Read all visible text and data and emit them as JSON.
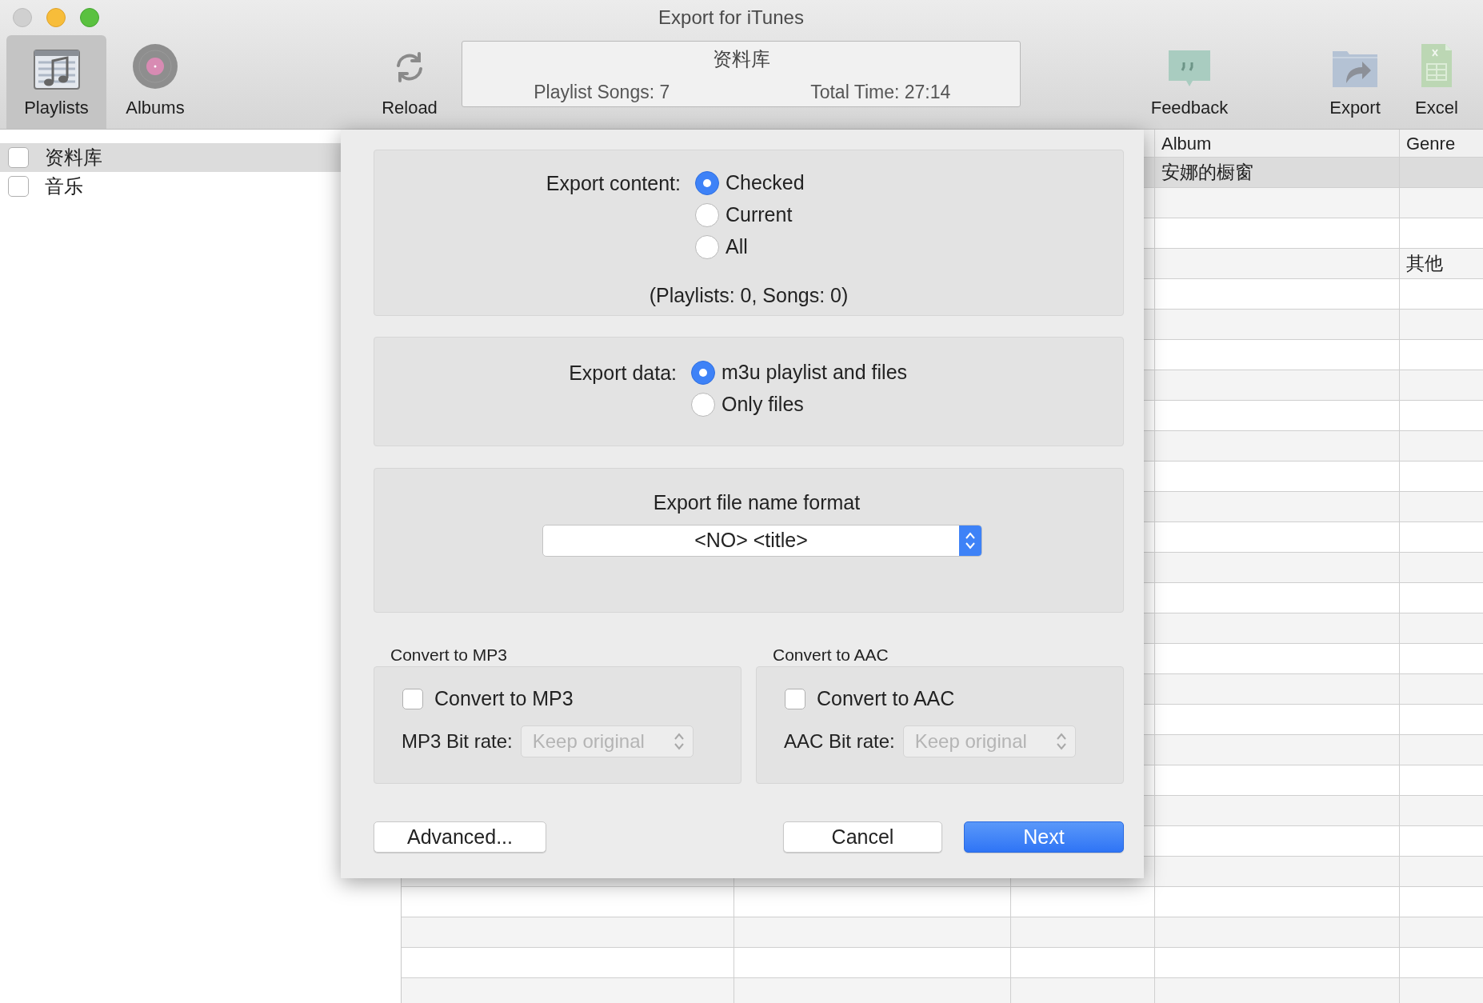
{
  "window": {
    "title": "Export for iTunes"
  },
  "toolbar": {
    "views": [
      {
        "label": "Playlists",
        "kind": "playlists",
        "selected": true
      },
      {
        "label": "Albums",
        "kind": "albums",
        "selected": false
      }
    ],
    "reload": {
      "label": "Reload"
    },
    "info": {
      "title": "资料库",
      "songs": "Playlist Songs: 7",
      "time": "Total Time: 27:14"
    },
    "actions": [
      {
        "label": "Feedback",
        "kind": "feedback"
      },
      {
        "label": "Export",
        "kind": "export"
      },
      {
        "label": "Excel",
        "kind": "excel"
      }
    ]
  },
  "sidebar": {
    "items": [
      {
        "label": "资料库",
        "checked": false,
        "selected": true
      },
      {
        "label": "音乐",
        "checked": false,
        "selected": false
      }
    ]
  },
  "table": {
    "columns": [
      "Album",
      "Genre"
    ],
    "rows": [
      {
        "album": "安娜的橱窗",
        "selected": true
      },
      {
        "selected": false
      },
      {
        "selected": false
      },
      {
        "genre": "其他",
        "selected": false
      }
    ]
  },
  "dialog": {
    "export_content": {
      "label": "Export content:",
      "options": [
        {
          "label": "Checked",
          "selected": true
        },
        {
          "label": "Current",
          "selected": false
        },
        {
          "label": "All",
          "selected": false
        }
      ],
      "summary": "(Playlists: 0, Songs: 0)"
    },
    "export_data": {
      "label": "Export data:",
      "options": [
        {
          "label": "m3u playlist and files",
          "selected": true
        },
        {
          "label": "Only files",
          "selected": false
        }
      ]
    },
    "file_name_format": {
      "label": "Export file name format",
      "value": "<NO> <title>"
    },
    "converters": [
      {
        "title": "Convert to MP3",
        "checkbox": "Convert to MP3",
        "checked": false,
        "bitrate_label": "MP3 Bit rate:",
        "bitrate": "Keep original",
        "disabled": true
      },
      {
        "title": "Convert to AAC",
        "checkbox": "Convert to AAC",
        "checked": false,
        "bitrate_label": "AAC Bit rate:",
        "bitrate": "Keep original",
        "disabled": true
      }
    ],
    "buttons": [
      {
        "label": "Advanced...",
        "kind": "normal"
      },
      {
        "label": "Cancel",
        "kind": "normal"
      },
      {
        "label": "Next",
        "kind": "primary"
      }
    ]
  }
}
